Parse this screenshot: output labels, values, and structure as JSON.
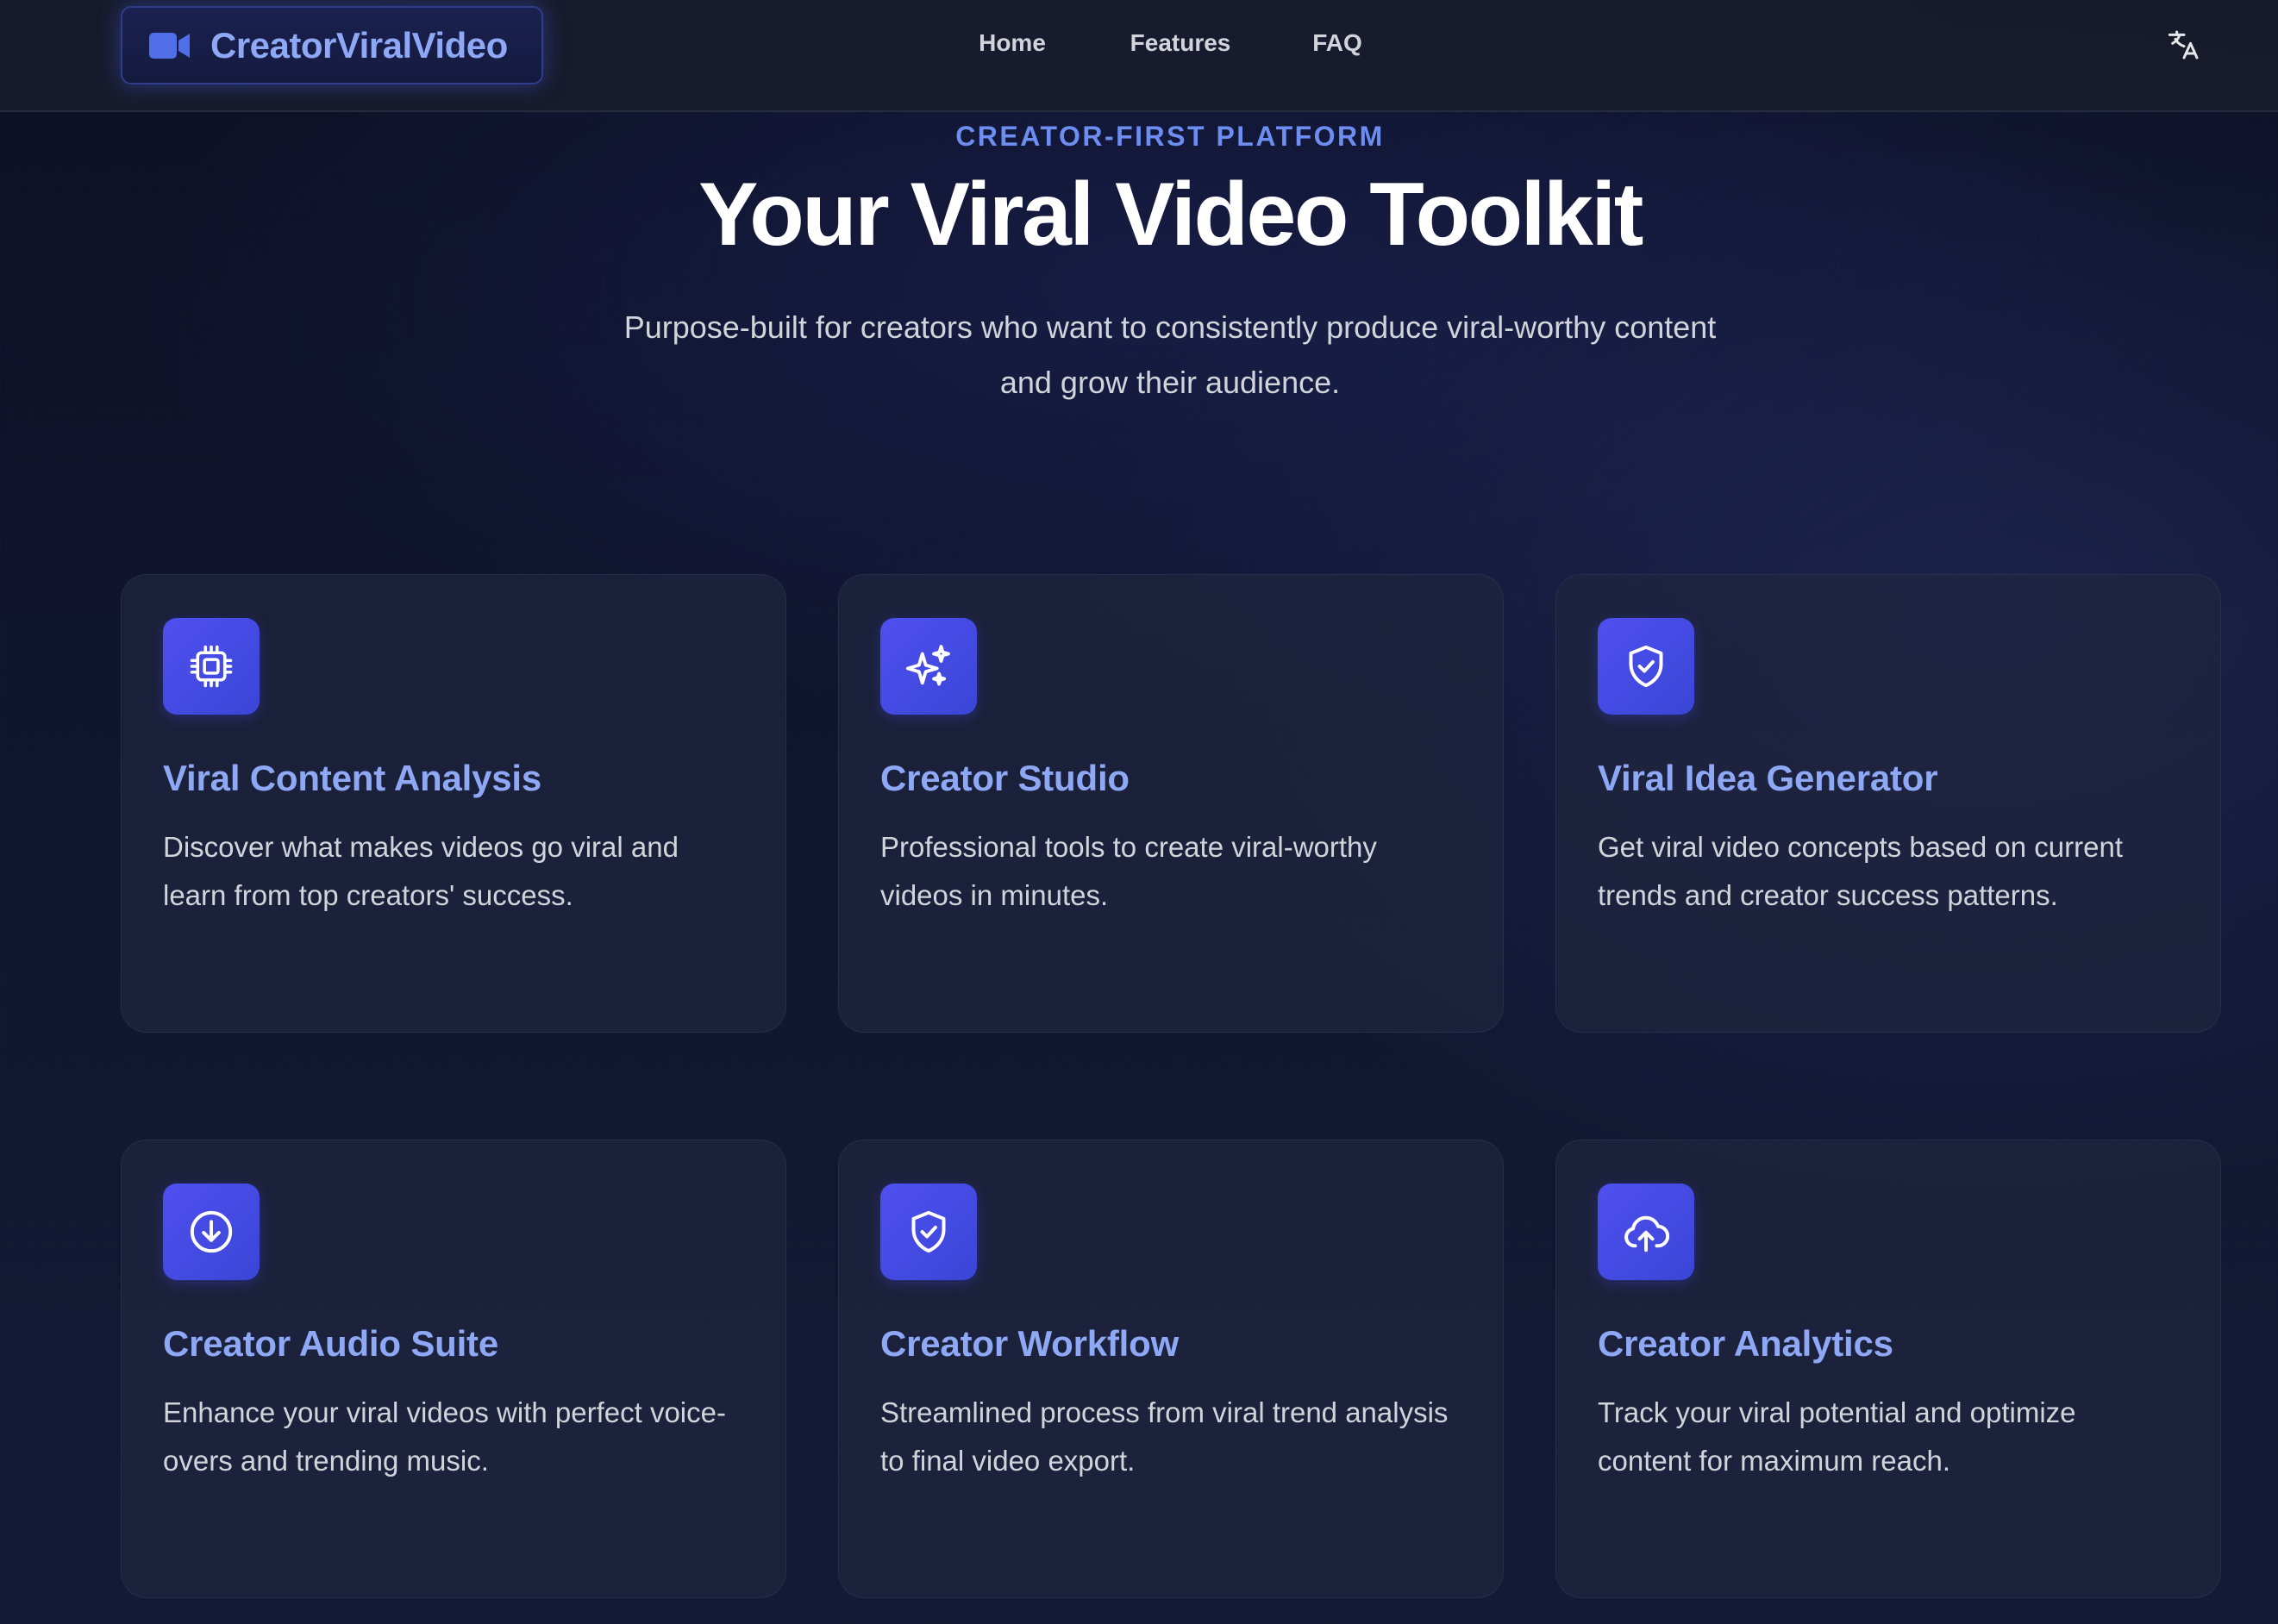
{
  "header": {
    "logo_text": "CreatorViralVideo",
    "logo_icon": "video-camera-icon",
    "nav": [
      {
        "label": "Home"
      },
      {
        "label": "Features"
      },
      {
        "label": "FAQ"
      }
    ],
    "language_icon": "translate-icon"
  },
  "hero": {
    "eyebrow": "CREATOR-FIRST PLATFORM",
    "title": "Your Viral Video Toolkit",
    "subtitle": "Purpose-built for creators who want to consistently produce viral-worthy content and grow their audience."
  },
  "features": [
    {
      "icon": "cpu-chip-icon",
      "title": "Viral Content Analysis",
      "description": "Discover what makes videos go viral and learn from top creators' success."
    },
    {
      "icon": "sparkles-icon",
      "title": "Creator Studio",
      "description": "Professional tools to create viral-worthy videos in minutes."
    },
    {
      "icon": "shield-check-icon",
      "title": "Viral Idea Generator",
      "description": "Get viral video concepts based on current trends and creator success patterns."
    },
    {
      "icon": "download-circle-icon",
      "title": "Creator Audio Suite",
      "description": "Enhance your viral videos with perfect voice-overs and trending music."
    },
    {
      "icon": "shield-check-icon",
      "title": "Creator Workflow",
      "description": "Streamlined process from viral trend analysis to final video export."
    },
    {
      "icon": "cloud-upload-icon",
      "title": "Creator Analytics",
      "description": "Track your viral potential and optimize content for maximum reach."
    }
  ],
  "colors": {
    "accent": "#8ea8f5",
    "icon_bg": "#4648e6",
    "background": "#10152e"
  }
}
